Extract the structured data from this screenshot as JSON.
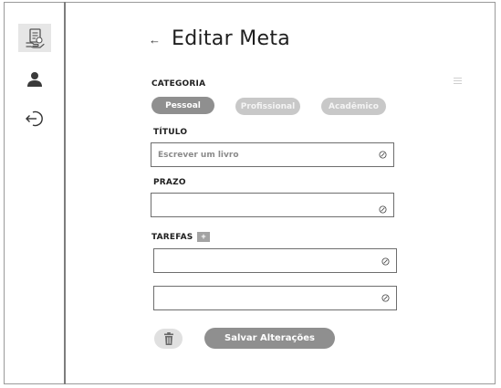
{
  "sidebar": {
    "items": [
      {
        "icon": "goals-document-icon",
        "active": true
      },
      {
        "icon": "user-icon",
        "active": false
      },
      {
        "icon": "logout-icon",
        "active": false
      }
    ]
  },
  "header": {
    "back_icon": "←",
    "title": "Editar Meta"
  },
  "categoria": {
    "label": "CATEGORIA",
    "options": [
      "Pessoal",
      "Profissional",
      "Acadêmico"
    ],
    "selected": "Pessoal"
  },
  "titulo": {
    "label": "TÍTULO",
    "placeholder": "Escrever um livro",
    "value": ""
  },
  "prazo": {
    "label": "PRAZO",
    "placeholder": "",
    "value": ""
  },
  "tarefas": {
    "label": "TAREFAS",
    "add_label": "+",
    "items": [
      {
        "placeholder": "",
        "value": ""
      },
      {
        "placeholder": "",
        "value": ""
      }
    ]
  },
  "actions": {
    "save_label": "Salvar Alterações",
    "delete_icon": "trash-icon"
  },
  "colors": {
    "primary_gray": "#8f8f8f",
    "light_gray": "#c8c8c8",
    "border": "#6e6e6e"
  }
}
